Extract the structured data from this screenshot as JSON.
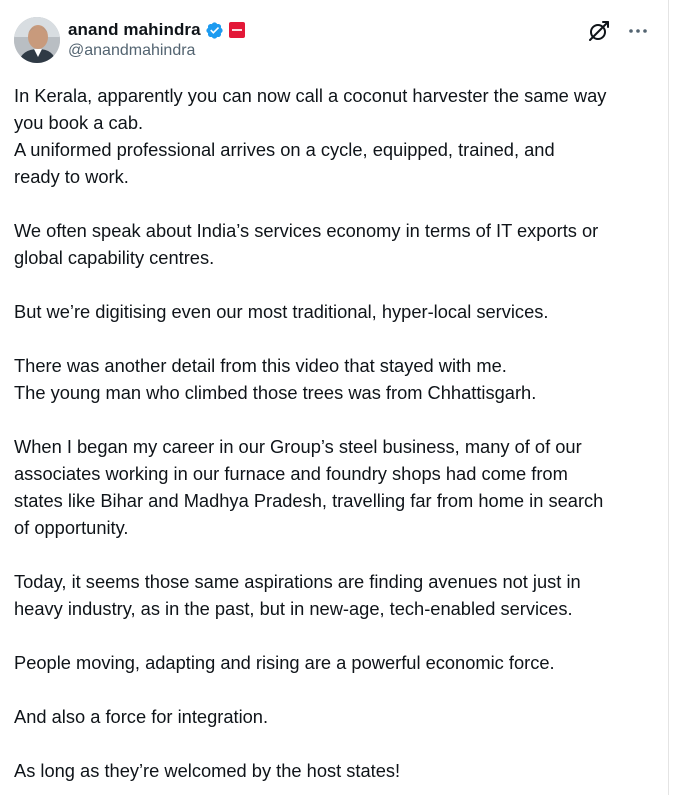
{
  "post": {
    "author": {
      "display_name": "anand mahindra",
      "handle": "@anandmahindra",
      "verified": true,
      "affiliate_badge_color": "#e31837"
    },
    "colors": {
      "text": "#0f1419",
      "secondary_text": "#536471",
      "verified_blue": "#1d9bf0"
    },
    "icons": [
      "verified-badge-icon",
      "affiliate-badge-icon",
      "grok-icon",
      "more-icon"
    ],
    "paragraphs": [
      {
        "lines": [
          "In Kerala, apparently you can now call a coconut harvester the same way",
          "you book a cab.",
          "A uniformed professional arrives on a cycle, equipped, trained, and",
          "ready to work."
        ]
      },
      {
        "lines": [
          "We often speak about India’s services economy in terms of IT exports or",
          "global capability centres."
        ]
      },
      {
        "lines": [
          "But we’re digitising even our most traditional, hyper-local services."
        ]
      },
      {
        "lines": [
          "There was another detail from this video that stayed with me.",
          "The young man who climbed those trees was from Chhattisgarh."
        ]
      },
      {
        "lines": [
          "When I began my career in our Group’s steel business, many of of our",
          "associates working in our furnace and foundry shops had come from",
          "states like Bihar and Madhya Pradesh, travelling far from home in search",
          "of opportunity."
        ]
      },
      {
        "lines": [
          "Today, it seems those same aspirations are finding avenues not just in",
          "heavy industry, as in the past, but in new-age, tech-enabled services."
        ]
      },
      {
        "lines": [
          "People moving, adapting and rising are a powerful economic force."
        ]
      },
      {
        "lines": [
          "And also a force for integration."
        ]
      },
      {
        "lines": [
          "As long as they’re welcomed by the host states!"
        ]
      }
    ]
  }
}
